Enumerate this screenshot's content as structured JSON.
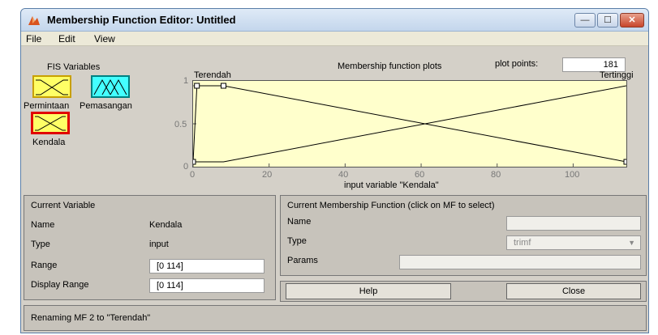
{
  "window": {
    "title": "Membership Function Editor: Untitled",
    "controls": {
      "minimize": "—",
      "maximize": "☐",
      "close": "✕"
    }
  },
  "menu": {
    "file": "File",
    "edit": "Edit",
    "view": "View"
  },
  "fis_variables": {
    "heading": "FIS Variables",
    "items": [
      {
        "label": "Permintaan",
        "color": "#ffff66"
      },
      {
        "label": "Pemasangan",
        "color": "#44ffff"
      },
      {
        "label": "Kendala",
        "color": "#ffff66",
        "selected": true
      }
    ]
  },
  "plot": {
    "heading": "Membership function plots",
    "plot_points_label": "plot points:",
    "plot_points_value": "181",
    "xlabel": "input variable \"Kendala\"",
    "mf_labels": {
      "left": "Terendah",
      "right": "Tertinggi"
    },
    "y_ticks": [
      "1",
      "0.5",
      "0"
    ],
    "x_ticks": [
      "0",
      "20",
      "40",
      "60",
      "80",
      "100"
    ]
  },
  "chart_data": {
    "type": "line",
    "xlabel": "input variable \"Kendala\"",
    "ylabel": "",
    "xlim": [
      0,
      114
    ],
    "ylim": [
      0,
      1
    ],
    "series": [
      {
        "name": "Terendah",
        "x": [
          0,
          1,
          8,
          114
        ],
        "y": [
          0,
          1,
          1,
          0
        ]
      },
      {
        "name": "Tertinggi",
        "x": [
          0,
          8,
          114
        ],
        "y": [
          0,
          0,
          1
        ]
      }
    ]
  },
  "current_variable": {
    "heading": "Current Variable",
    "name_label": "Name",
    "name_value": "Kendala",
    "type_label": "Type",
    "type_value": "input",
    "range_label": "Range",
    "range_value": "[0 114]",
    "display_range_label": "Display Range",
    "display_range_value": "[0 114]"
  },
  "current_mf": {
    "heading": "Current Membership Function (click on MF to select)",
    "name_label": "Name",
    "name_value": "",
    "type_label": "Type",
    "type_value": "trimf",
    "params_label": "Params",
    "params_value": ""
  },
  "buttons": {
    "help": "Help",
    "close": "Close"
  },
  "status": {
    "message": "Renaming MF 2 to \"Terendah\""
  }
}
